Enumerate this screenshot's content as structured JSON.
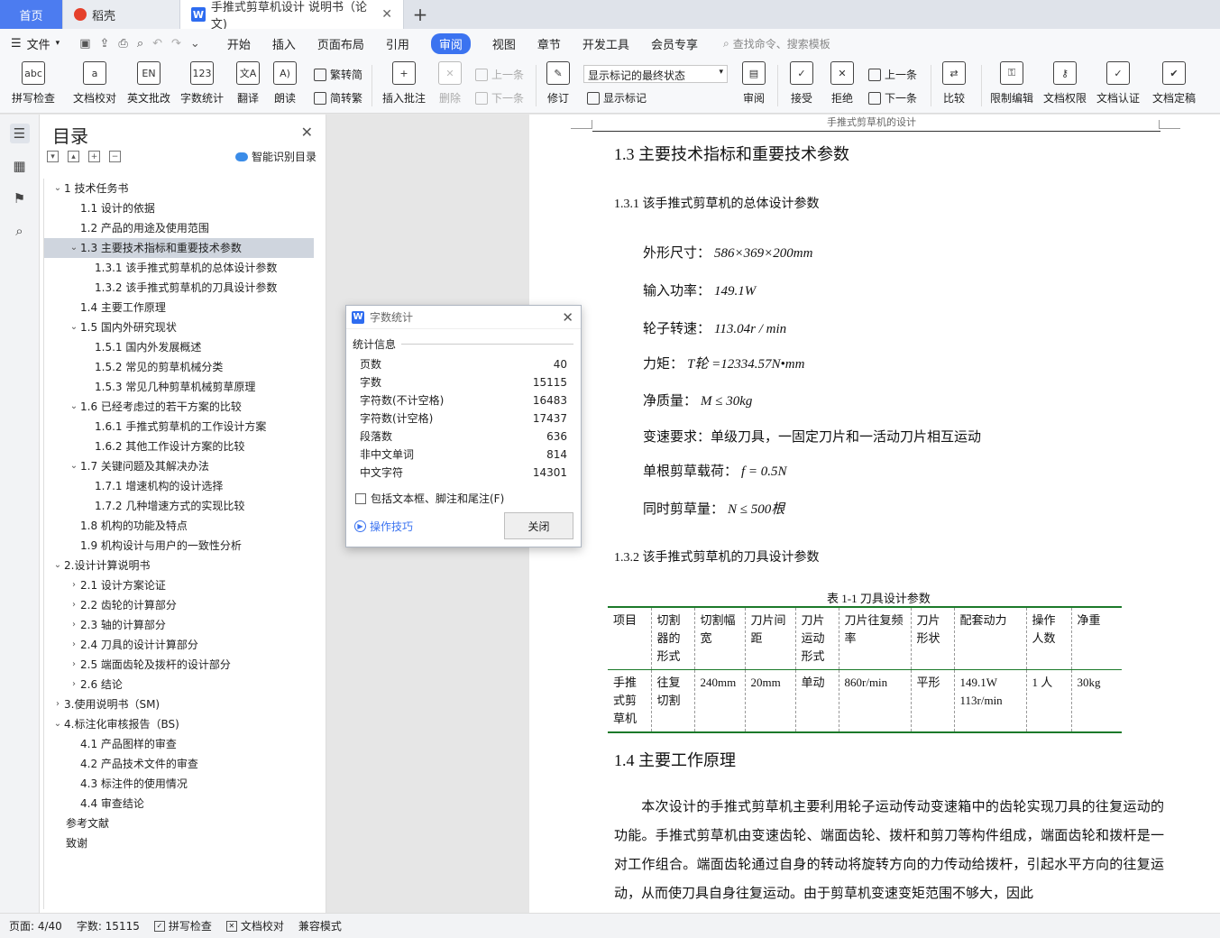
{
  "tabs": {
    "home": "首页",
    "daoke": "稻壳",
    "doc": "手推式剪草机设计 说明书（论文)",
    "add": "+"
  },
  "menu": {
    "file": "文件",
    "items": [
      "开始",
      "插入",
      "页面布局",
      "引用",
      "审阅",
      "视图",
      "章节",
      "开发工具",
      "会员专享"
    ],
    "search": "查找命令、搜索模板"
  },
  "ribbon": {
    "spell": "拼写检查",
    "proof": "文档校对",
    "en": "英文批改",
    "count": "字数统计",
    "translate": "翻译",
    "read": "朗读",
    "trad": "繁转简",
    "simp": "简转繁",
    "comment": "插入批注",
    "delete": "删除",
    "prev": "上一条",
    "next": "下一条",
    "revise": "修订",
    "markup_select": "显示标记的最终状态",
    "show_markup": "显示标记",
    "review": "审阅",
    "accept": "接受",
    "reject": "拒绝",
    "prev2": "上一条",
    "next2": "下一条",
    "compare": "比较",
    "restrict": "限制编辑",
    "rights": "文档权限",
    "cert": "文档认证",
    "final": "文档定稿"
  },
  "toc": {
    "title": "目录",
    "smart": "智能识别目录",
    "items": [
      {
        "label": "1  技术任务书",
        "level": 1,
        "arrow": "down"
      },
      {
        "label": "1.1  设计的依据",
        "level": 2,
        "arrow": ""
      },
      {
        "label": "1.2 产品的用途及使用范围",
        "level": 2,
        "arrow": ""
      },
      {
        "label": "1.3 主要技术指标和重要技术参数",
        "level": 2,
        "arrow": "down",
        "selected": true
      },
      {
        "label": "1.3.1  该手推式剪草机的总体设计参数",
        "level": 3,
        "arrow": ""
      },
      {
        "label": "1.3.2  该手推式剪草机的刀具设计参数",
        "level": 3,
        "arrow": ""
      },
      {
        "label": "1.4 主要工作原理",
        "level": 2,
        "arrow": ""
      },
      {
        "label": "1.5 国内外研究现状",
        "level": 2,
        "arrow": "down"
      },
      {
        "label": "1.5.1  国内外发展概述",
        "level": 3,
        "arrow": ""
      },
      {
        "label": "1.5.2  常见的剪草机械分类",
        "level": 3,
        "arrow": ""
      },
      {
        "label": "1.5.3  常见几种剪草机械剪草原理",
        "level": 3,
        "arrow": ""
      },
      {
        "label": "1.6 已经考虑过的若干方案的比较",
        "level": 2,
        "arrow": "down"
      },
      {
        "label": "1.6.1 手推式剪草机的工作设计方案",
        "level": 3,
        "arrow": ""
      },
      {
        "label": "1.6.2 其他工作设计方案的比较",
        "level": 3,
        "arrow": ""
      },
      {
        "label": "1.7 关键问题及其解决办法",
        "level": 2,
        "arrow": "down"
      },
      {
        "label": "1.7.1  增速机构的设计选择",
        "level": 3,
        "arrow": ""
      },
      {
        "label": "1.7.2  几种增速方式的实现比较",
        "level": 3,
        "arrow": ""
      },
      {
        "label": "1.8    机构的功能及特点",
        "level": 2,
        "arrow": ""
      },
      {
        "label": "1.9 机构设计与用户的一致性分析",
        "level": 2,
        "arrow": ""
      },
      {
        "label": "2.设计计算说明书",
        "level": 1,
        "arrow": "down"
      },
      {
        "label": "2.1  设计方案论证",
        "level": 2,
        "arrow": "right"
      },
      {
        "label": "2.2  齿轮的计算部分",
        "level": 2,
        "arrow": "right"
      },
      {
        "label": "2.3  轴的计算部分",
        "level": 2,
        "arrow": "right"
      },
      {
        "label": "2.4  刀具的设计计算部分",
        "level": 2,
        "arrow": "right"
      },
      {
        "label": "2.5  端面齿轮及拨杆的设计部分",
        "level": 2,
        "arrow": "right"
      },
      {
        "label": "2.6  结论",
        "level": 2,
        "arrow": "right"
      },
      {
        "label": "3.使用说明书（SM)",
        "level": 1,
        "arrow": "right"
      },
      {
        "label": "4.标注化审核报告（BS)",
        "level": 1,
        "arrow": "down"
      },
      {
        "label": "4.1  产品图样的审查",
        "level": 2,
        "arrow": ""
      },
      {
        "label": "4.2 产品技术文件的审查",
        "level": 2,
        "arrow": ""
      },
      {
        "label": "4.3  标注件的使用情况",
        "level": 2,
        "arrow": ""
      },
      {
        "label": "4.4  审查结论",
        "level": 2,
        "arrow": ""
      },
      {
        "label": "参考文献",
        "level": 1,
        "arrow": ""
      },
      {
        "label": "致谢",
        "level": 1,
        "arrow": ""
      }
    ]
  },
  "doc": {
    "header": "手推式剪草机的设计",
    "h_13": "1.3 主要技术指标和重要技术参数",
    "h_131": "1.3.1  该手推式剪草机的总体设计参数",
    "params": [
      {
        "label": "外形尺寸：",
        "value": "586×369×200mm"
      },
      {
        "label": "输入功率：",
        "value": "149.1W"
      },
      {
        "label": "轮子转速：",
        "value": "113.04r / min"
      },
      {
        "label": "力矩：",
        "value": "T轮 =12334.57N•mm"
      },
      {
        "label": "净质量：",
        "value": "M ≤ 30kg"
      },
      {
        "label": "变速要求：",
        "value": "单级刀具，一固定刀片和一活动刀片相互运动"
      },
      {
        "label": "单根剪草载荷：",
        "value": "f = 0.5N"
      },
      {
        "label": "同时剪草量：",
        "value": "N ≤ 500根"
      }
    ],
    "h_132": "1.3.2  该手推式剪草机的刀具设计参数",
    "table_caption": "表 1-1  刀具设计参数",
    "table_headers": [
      "项目",
      "切割器的形式",
      "切割幅宽",
      "刀片间距",
      "刀片运动形式",
      "刀片往复频率",
      "刀片形状",
      "配套动力",
      "操作人数",
      "净重"
    ],
    "table_row": [
      "手推式剪草机",
      "往复切割",
      "240mm",
      "20mm",
      "单动",
      "860r/min",
      "平形",
      "149.1W 113r/min",
      "1 人",
      "30kg"
    ],
    "h_14": "1.4 主要工作原理",
    "paragraph": "本次设计的手推式剪草机主要利用轮子运动传动变速箱中的齿轮实现刀具的往复运动的功能。手推式剪草机由变速齿轮、端面齿轮、拨杆和剪刀等构件组成，端面齿轮和拨杆是一对工作组合。端面齿轮通过自身的转动将旋转方向的力传动给拨杆，引起水平方向的往复运动，从而使刀具自身往复运动。由于剪草机变速变矩范围不够大，因此"
  },
  "dialog": {
    "title": "字数统计",
    "section": "统计信息",
    "rows": [
      {
        "k": "页数",
        "v": "40"
      },
      {
        "k": "字数",
        "v": "15115"
      },
      {
        "k": "字符数(不计空格)",
        "v": "16483"
      },
      {
        "k": "字符数(计空格)",
        "v": "17437"
      },
      {
        "k": "段落数",
        "v": "636"
      },
      {
        "k": "非中文单词",
        "v": "814"
      },
      {
        "k": "中文字符",
        "v": "14301"
      }
    ],
    "checkbox": "包括文本框、脚注和尾注(F)",
    "tips": "操作技巧",
    "close": "关闭"
  },
  "status": {
    "page": "页面: 4/40",
    "words": "字数: 15115",
    "spell": "拼写检查",
    "proof": "文档校对",
    "compat": "兼容模式"
  }
}
